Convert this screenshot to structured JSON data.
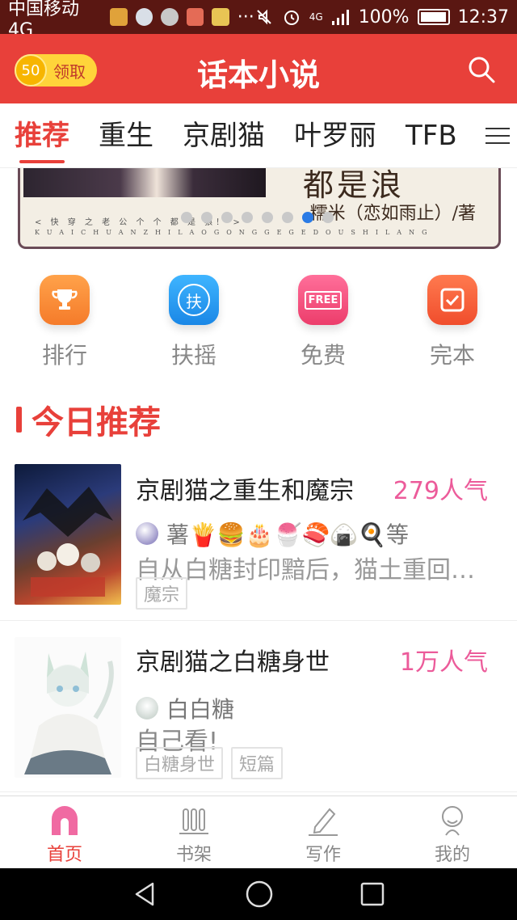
{
  "status_bar": {
    "carrier": "中国移动4G",
    "more": "···",
    "battery": "100%",
    "time": "12:37",
    "signal": "4G"
  },
  "header": {
    "coin_value": "50",
    "coin_label": "领取",
    "title": "话本小说",
    "accent": "#e8403a"
  },
  "tabs": {
    "items": [
      "推荐",
      "重生",
      "京剧猫",
      "叶罗丽",
      "TFB"
    ],
    "active": "推荐"
  },
  "banner": {
    "big_text": "都是浪",
    "author": "糯米（恋如雨止）/著",
    "line1": "< 快 穿 之 老 公 个 个 都 是 狼！ >",
    "line2": "KUAICHUANZHILAOGONGGEGEDOUSHILANG",
    "page_count": 8,
    "active_index": 6
  },
  "quick": [
    {
      "label": "排行",
      "icon": "trophy-icon",
      "color": "#f7893a"
    },
    {
      "label": "扶摇",
      "icon": "fuyao-icon",
      "glyph": "扶",
      "color": "#2a9ff0"
    },
    {
      "label": "免费",
      "icon": "free-icon",
      "glyph": "FREE",
      "color": "#f0527a"
    },
    {
      "label": "完本",
      "icon": "check-icon",
      "color": "#f5603a"
    }
  ],
  "section": {
    "title": "今日推荐"
  },
  "books": [
    {
      "title": "京剧猫之重生和魔宗",
      "popularity": "279人气",
      "author": "薯🍟🍔🎂🍧🍣🍙🍳等",
      "desc": "自从白糖封印黯后，猫土重回平静",
      "tags": [
        "魔宗"
      ]
    },
    {
      "title": "京剧猫之白糖身世",
      "popularity": "1万人气",
      "author": "白白糖",
      "desc": "自己看!",
      "tags": [
        "白糖身世",
        "短篇"
      ]
    }
  ],
  "bottom_nav": [
    {
      "label": "首页",
      "active": true
    },
    {
      "label": "书架",
      "active": false
    },
    {
      "label": "写作",
      "active": false
    },
    {
      "label": "我的",
      "active": false
    }
  ]
}
